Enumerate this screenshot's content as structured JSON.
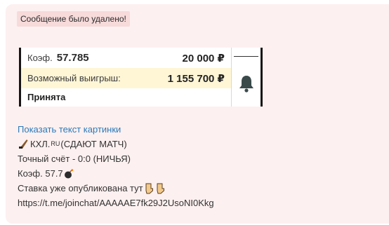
{
  "deleted_notice": "Сообщение было удалено!",
  "bet_card": {
    "coef_label": "Коэф.",
    "coef_value": "57.785",
    "stake": "20 000 ₽",
    "possible_win_label": "Возможный выигрыш:",
    "possible_win": "1 155 700 ₽",
    "status": "Принята",
    "icons": {
      "top": "dash-icon",
      "bottom": "bell-icon"
    }
  },
  "message": {
    "show_image_text_link": "Показать текст картинки",
    "team_prefix": "КХЛ.",
    "team_domain": "RU",
    "team_suffix": "(СДАЮТ МАТЧ)",
    "exact_score": "Точный счёт - 0:0 (НИЧЬЯ)",
    "coef_line": "Коэф. 57.7",
    "published": "Ставка уже опубликована тут",
    "url": "https://t.me/joinchat/AAAAAE7fk29J2UsoNI0Kkg",
    "icons": [
      "hockey-stick-icon",
      "bomb-icon",
      "pointing-down-icon",
      "pointing-down-icon"
    ]
  },
  "colors": {
    "bubble_bg": "#fdf0f0",
    "badge_bg": "#f7dada",
    "highlight_row": "#fff6d6",
    "link": "#2a7ab8"
  }
}
